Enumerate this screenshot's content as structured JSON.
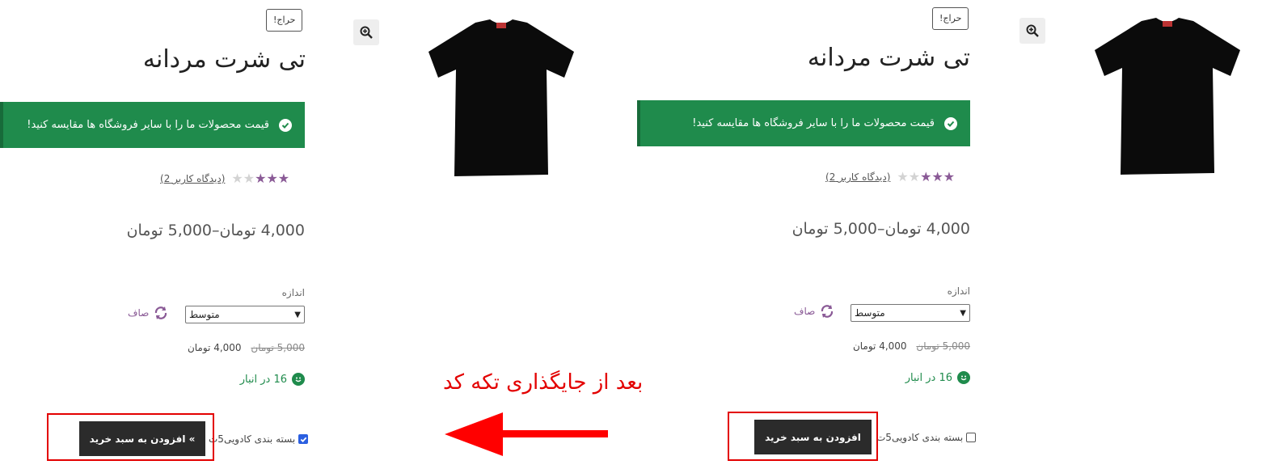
{
  "product": {
    "sale_badge": "حراج!",
    "title": "تی شرت مردانه",
    "notice": "قیمت محصولات ما را با سایر فروشگاه ها مقایسه کنید!",
    "rating_value": 3,
    "rating_max": 5,
    "review_link": "(دیدگاه کاربر 2)",
    "price_range": "4,000 تومان–5,000 تومان",
    "size_label": "اندازه",
    "size_selected": "متوسط",
    "clear_label": "صاف",
    "old_price": "5,000 تومان",
    "new_price": "4,000 تومان",
    "stock": "16 در انبار",
    "gift_wrap_label": "بسته بندی کادویی5ت",
    "accent_color": "#1f8b4c",
    "star_color": "#8a5a96"
  },
  "left_panel": {
    "gift_wrap_checked": true,
    "cart_button": "» افزودن به سبد خرید"
  },
  "right_panel": {
    "gift_wrap_checked": false,
    "cart_button": "افزودن به سبد خرید"
  },
  "annotation": {
    "caption": "بعد از جایگذاری تکه کد",
    "color": "#e30000"
  },
  "icons": [
    "zoom-in-icon",
    "check-circle-icon",
    "star-icon",
    "refresh-icon",
    "smiley-icon",
    "chevron-down-icon",
    "arrow-left-icon"
  ]
}
